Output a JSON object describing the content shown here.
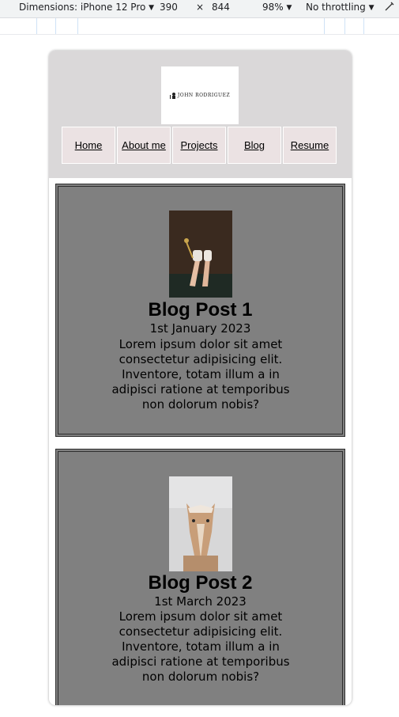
{
  "devtools": {
    "dimensions_label": "Dimensions: iPhone 12 Pro",
    "width": "390",
    "times": "×",
    "height": "844",
    "zoom": "98%",
    "throttling": "No throttling"
  },
  "site": {
    "logo_text": "JOHN RODRIGUEZ",
    "nav": [
      {
        "label": "Home"
      },
      {
        "label": "About me"
      },
      {
        "label": "Projects"
      },
      {
        "label": "Blog"
      },
      {
        "label": "Resume"
      }
    ]
  },
  "posts": [
    {
      "title": "Blog Post 1",
      "date": "1st January 2023",
      "body": "Lorem ipsum dolor sit amet consectetur adipisicing elit. Inventore, totam illum a in adipisci ratione at temporibus non dolorum nobis?"
    },
    {
      "title": "Blog Post 2",
      "date": "1st March 2023",
      "body": "Lorem ipsum dolor sit amet consectetur adipisicing elit. Inventore, totam illum a in adipisci ratione at temporibus non dolorum nobis?"
    }
  ],
  "colors": {
    "header_bg": "#dad8d9",
    "nav_bg": "#ebe2e3",
    "post_bg": "#808080"
  }
}
